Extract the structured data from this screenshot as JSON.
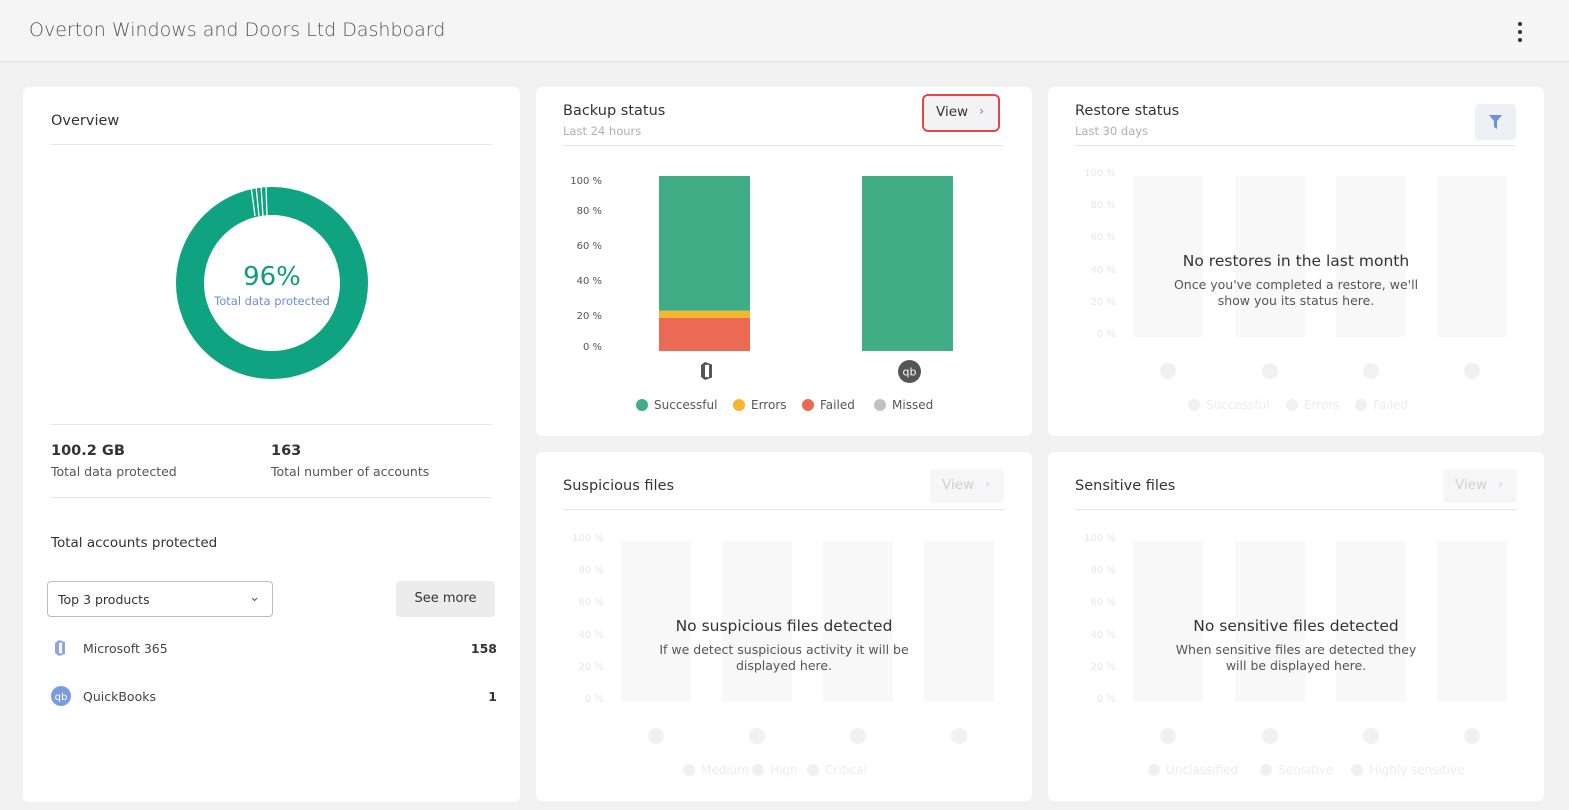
{
  "header": {
    "title": "Overton Windows and Doors Ltd Dashboard"
  },
  "overview": {
    "title": "Overview",
    "donut_percent": "96%",
    "donut_label": "Total data protected",
    "protected_fraction": 0.96,
    "stats": [
      {
        "value": "100.2 GB",
        "label": "Total data protected"
      },
      {
        "value": "163",
        "label": "Total number of accounts"
      }
    ],
    "accounts_title": "Total accounts protected",
    "dropdown_value": "Top 3 products",
    "see_more": "See more",
    "products": [
      {
        "name": "Microsoft 365",
        "count": "158",
        "icon": "microsoft-365-icon"
      },
      {
        "name": "QuickBooks",
        "count": "1",
        "icon": "quickbooks-icon"
      }
    ]
  },
  "backup": {
    "title": "Backup status",
    "subtitle": "Last 24 hours",
    "view_label": "View",
    "chart_data": {
      "type": "bar",
      "stacked": true,
      "categories": [
        "Microsoft 365",
        "QuickBooks"
      ],
      "yticks": [
        "100 %",
        "80 %",
        "60 %",
        "40 %",
        "20 %",
        "0 %"
      ],
      "ylim": [
        0,
        100
      ],
      "series": [
        {
          "name": "Successful",
          "color": "#41ad87",
          "values": [
            77,
            100
          ]
        },
        {
          "name": "Errors",
          "color": "#f6b52b",
          "values": [
            4,
            0
          ]
        },
        {
          "name": "Failed",
          "color": "#eb6a54",
          "values": [
            19,
            0
          ]
        },
        {
          "name": "Missed",
          "color": "#c1c1c1",
          "values": [
            0,
            0
          ]
        }
      ]
    }
  },
  "restore": {
    "title": "Restore status",
    "subtitle": "Last 30 days",
    "empty_title": "No restores in the last month",
    "empty_msg": "Once you've completed a restore, we'll show you its status here.",
    "yticks": [
      "100 %",
      "80 %",
      "60 %",
      "40 %",
      "20 %",
      "0 %"
    ],
    "legend": [
      "Successful",
      "Errors",
      "Failed"
    ]
  },
  "suspicious": {
    "title": "Suspicious files",
    "view_label": "View",
    "empty_title": "No suspicious files detected",
    "empty_msg": "If we detect suspicious activity it will be displayed here.",
    "yticks": [
      "100 %",
      "80 %",
      "60 %",
      "40 %",
      "20 %",
      "0 %"
    ],
    "legend": [
      "Medium",
      "High",
      "Critical"
    ]
  },
  "sensitive": {
    "title": "Sensitive files",
    "view_label": "View",
    "empty_title": "No sensitive files detected",
    "empty_msg": "When sensitive files are detected they will be displayed here.",
    "yticks": [
      "100 %",
      "80 %",
      "60 %",
      "40 %",
      "20 %",
      "0 %"
    ],
    "legend": [
      "Unclassified",
      "Sensitive",
      "Highly sensitive"
    ]
  }
}
